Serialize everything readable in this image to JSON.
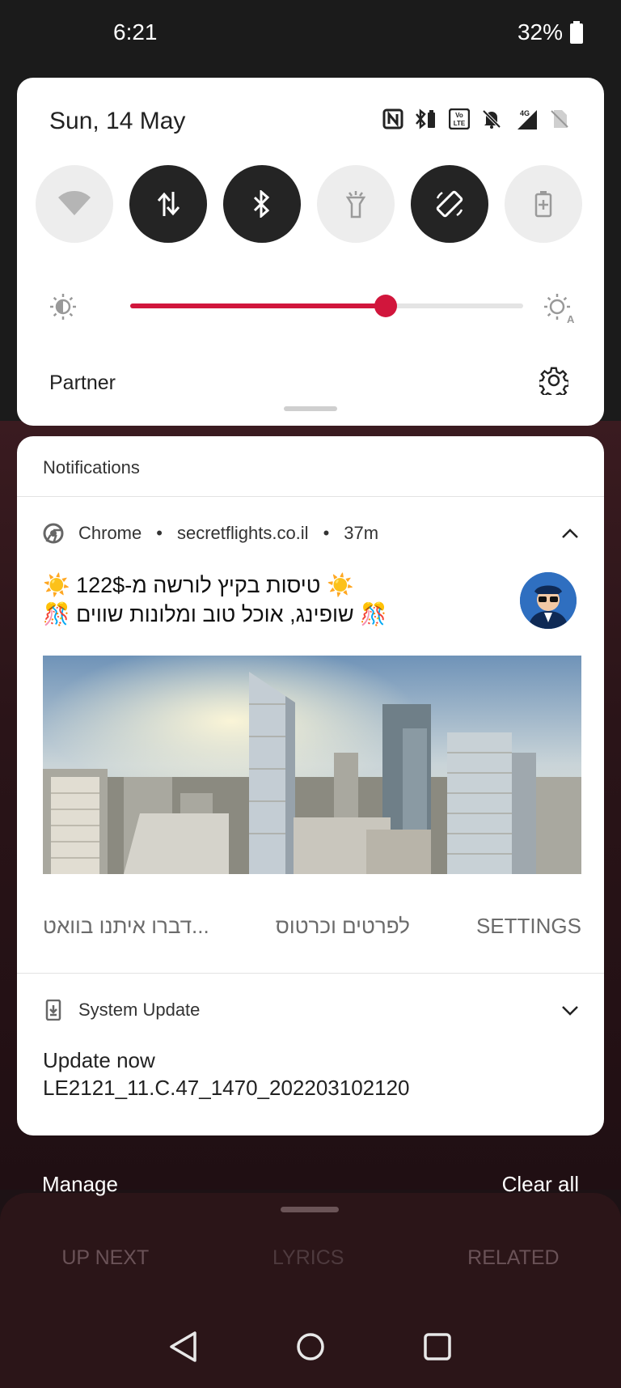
{
  "status_bar": {
    "time": "6:21",
    "battery": "32%"
  },
  "quick_settings": {
    "date": "Sun, 14 May",
    "carrier": "Partner",
    "brightness_level": 0.65,
    "accent_color": "#d1163c",
    "tiles": [
      {
        "name": "wifi",
        "on": false
      },
      {
        "name": "mobile-data",
        "on": true
      },
      {
        "name": "bluetooth",
        "on": true
      },
      {
        "name": "flashlight",
        "on": false
      },
      {
        "name": "auto-rotate",
        "on": true
      },
      {
        "name": "battery-saver",
        "on": false
      }
    ]
  },
  "notifications": {
    "header": "Notifications",
    "chrome": {
      "app": "Chrome",
      "site": "secretflights.co.il",
      "time": "37m",
      "line1": "☀️ טיסות בקיץ לורשה מ-122$ ☀️",
      "line2": "🎊 שופינג, אוכל טוב ומלונות שווים 🎊",
      "actions": [
        "דברו איתנו בוואט...",
        "לפרטים וכרטוס",
        "SETTINGS"
      ]
    },
    "system_update": {
      "app": "System Update",
      "title": "Update now",
      "version": "LE2121_11.C.47_1470_202203102120"
    }
  },
  "footer": {
    "manage": "Manage",
    "clear_all": "Clear all"
  },
  "player_tabs": [
    "UP NEXT",
    "LYRICS",
    "RELATED"
  ]
}
